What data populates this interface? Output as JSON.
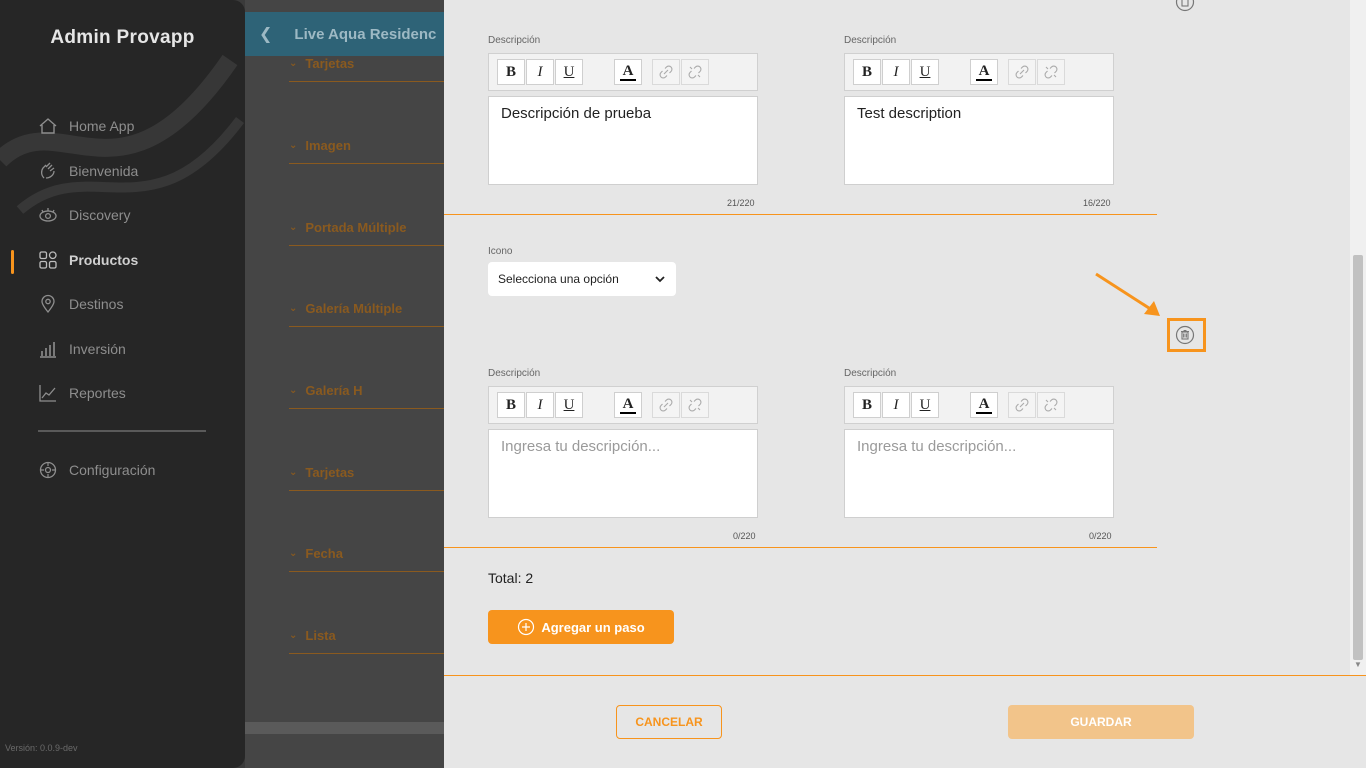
{
  "sidebar": {
    "app_title": "Admin Provapp",
    "items": [
      {
        "label": "Home App",
        "icon": "home-icon"
      },
      {
        "label": "Bienvenida",
        "icon": "wave-hand-icon"
      },
      {
        "label": "Discovery",
        "icon": "eye-icon"
      },
      {
        "label": "Productos",
        "icon": "grid-icon",
        "active": true
      },
      {
        "label": "Destinos",
        "icon": "location-pin-icon"
      },
      {
        "label": "Inversión",
        "icon": "bar-chart-icon"
      },
      {
        "label": "Reportes",
        "icon": "line-chart-icon"
      }
    ],
    "settings_label": "Configuración",
    "version": "Versión: 0.0.9-dev"
  },
  "background": {
    "title": "Live Aqua Residenc",
    "sections": [
      "Tarjetas",
      "Imagen",
      "Portada Múltiple",
      "Galería Múltiple",
      "Galería H",
      "Tarjetas",
      "Fecha",
      "Lista"
    ]
  },
  "modal": {
    "description_label": "Descripción",
    "icon_label": "Icono",
    "icon_select_value": "Selecciona una opción",
    "steps": [
      {
        "desc_es": "Descripción de prueba",
        "counter_es": "21/220",
        "desc_en": "Test description",
        "counter_en": "16/220"
      },
      {
        "placeholder_es": "Ingresa tu descripción...",
        "counter_es": "0/220",
        "placeholder_en": "Ingresa tu descripción...",
        "counter_en": "0/220"
      }
    ],
    "toolbar": {
      "bold": "B",
      "italic": "I",
      "underline": "U",
      "color": "A"
    },
    "total": "Total: 2",
    "add_step": "Agregar un paso",
    "cancel": "CANCELAR",
    "save": "GUARDAR"
  },
  "colors": {
    "accent": "#f7941d",
    "sidebar_bg": "#262626",
    "modal_bg": "#e6e6e6",
    "save_disabled": "#f2c48a"
  }
}
